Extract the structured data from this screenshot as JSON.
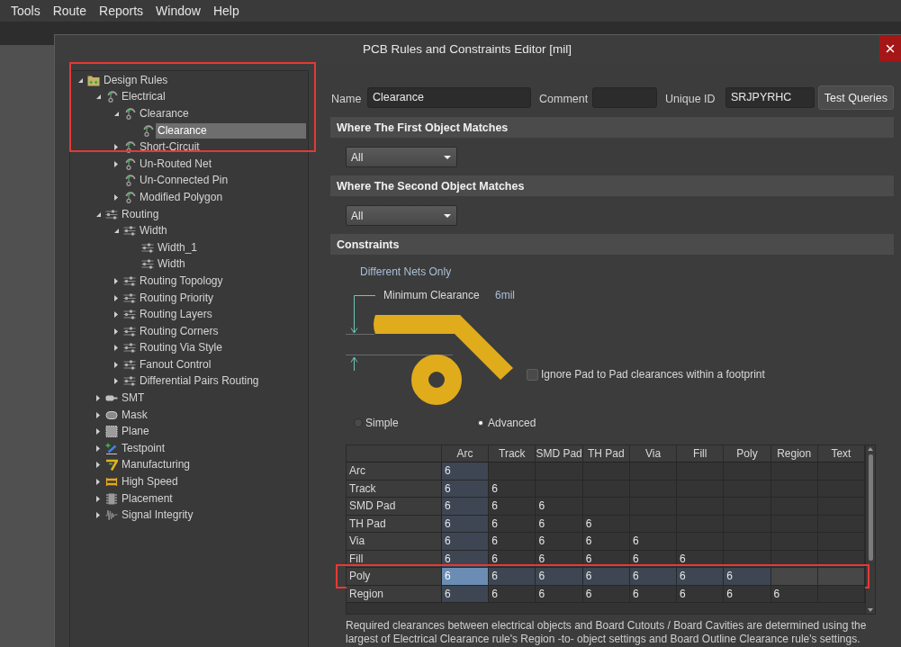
{
  "menu_bar": [
    {
      "label": "Tools"
    },
    {
      "label": "Route"
    },
    {
      "label": "Reports"
    },
    {
      "label": "Window"
    },
    {
      "label": "Help"
    }
  ],
  "dialog": {
    "title": "PCB Rules and Constraints Editor [mil]"
  },
  "tree": {
    "highlighted": true,
    "items": [
      {
        "label": "Design Rules",
        "kind": "folder",
        "expanded": true,
        "selected": false,
        "children": [
          {
            "label": "Electrical",
            "kind": "electrical",
            "expanded": true,
            "selected": false,
            "children": [
              {
                "label": "Clearance",
                "kind": "electrical",
                "expanded": true,
                "selected": false,
                "children": [
                  {
                    "label": "Clearance",
                    "kind": "electrical",
                    "selected": true
                  }
                ]
              },
              {
                "label": "Short-Circuit",
                "kind": "electrical",
                "expanded": false,
                "selected": false
              },
              {
                "label": "Un-Routed Net",
                "kind": "electrical",
                "expanded": false,
                "selected": false
              },
              {
                "label": "Un-Connected Pin",
                "kind": "electrical",
                "selected": false
              },
              {
                "label": "Modified Polygon",
                "kind": "electrical",
                "expanded": false,
                "selected": false
              }
            ]
          },
          {
            "label": "Routing",
            "kind": "routing",
            "expanded": true,
            "selected": false,
            "children": [
              {
                "label": "Width",
                "kind": "routing",
                "expanded": true,
                "selected": false,
                "children": [
                  {
                    "label": "Width_1",
                    "kind": "routing",
                    "selected": false
                  },
                  {
                    "label": "Width",
                    "kind": "routing",
                    "selected": false
                  }
                ]
              },
              {
                "label": "Routing Topology",
                "kind": "routing",
                "expanded": false,
                "selected": false
              },
              {
                "label": "Routing Priority",
                "kind": "routing",
                "expanded": false,
                "selected": false
              },
              {
                "label": "Routing Layers",
                "kind": "routing",
                "expanded": false,
                "selected": false
              },
              {
                "label": "Routing Corners",
                "kind": "routing",
                "expanded": false,
                "selected": false
              },
              {
                "label": "Routing Via Style",
                "kind": "routing",
                "expanded": false,
                "selected": false
              },
              {
                "label": "Fanout Control",
                "kind": "routing",
                "expanded": false,
                "selected": false
              },
              {
                "label": "Differential Pairs Routing",
                "kind": "routing",
                "expanded": false,
                "selected": false
              }
            ]
          },
          {
            "label": "SMT",
            "kind": "smt",
            "expanded": false,
            "selected": false
          },
          {
            "label": "Mask",
            "kind": "mask",
            "expanded": false,
            "selected": false
          },
          {
            "label": "Plane",
            "kind": "plane",
            "expanded": false,
            "selected": false
          },
          {
            "label": "Testpoint",
            "kind": "testpoint",
            "expanded": false,
            "selected": false
          },
          {
            "label": "Manufacturing",
            "kind": "manufacturing",
            "expanded": false,
            "selected": false
          },
          {
            "label": "High Speed",
            "kind": "high_speed",
            "expanded": false,
            "selected": false
          },
          {
            "label": "Placement",
            "kind": "placement",
            "expanded": false,
            "selected": false
          },
          {
            "label": "Signal Integrity",
            "kind": "signal_integrity",
            "expanded": false,
            "selected": false
          }
        ]
      }
    ]
  },
  "rule": {
    "name": {
      "label": "Name",
      "value": "Clearance"
    },
    "comment": {
      "label": "Comment"
    },
    "unique_id": {
      "label": "Unique ID",
      "value": "SRJPYRHC"
    },
    "test_button": "Test Queries"
  },
  "first_object": {
    "heading": "Where The First Object Matches",
    "scope": "All"
  },
  "second_object": {
    "heading": "Where The Second Object Matches",
    "scope": "All"
  },
  "constraints": {
    "heading": "Constraints",
    "net_scope": "Different Nets Only",
    "clearance_label": "Minimum Clearance",
    "clearance_value": "6mil",
    "ignore_pad_to_pad": {
      "label": "Ignore Pad to Pad clearances within a footprint",
      "checked": false
    },
    "modes": [
      {
        "label": "Simple",
        "selected": false
      },
      {
        "label": "Advanced",
        "selected": true
      }
    ],
    "table": {
      "columns": [
        {
          "label": "Arc",
          "selected": true
        },
        {
          "label": "Track",
          "selected": false
        },
        {
          "label": "SMD Pad",
          "selected": false
        },
        {
          "label": "TH Pad",
          "selected": false
        },
        {
          "label": "Via",
          "selected": false
        },
        {
          "label": "Fill",
          "selected": false
        },
        {
          "label": "Poly",
          "selected": false
        },
        {
          "label": "Region",
          "selected": false
        },
        {
          "label": "Text",
          "selected": false
        }
      ],
      "rows": [
        {
          "label": "Arc",
          "selected": false,
          "highlighted": false,
          "cells": [
            "6"
          ]
        },
        {
          "label": "Track",
          "selected": false,
          "highlighted": false,
          "cells": [
            "6",
            "6"
          ]
        },
        {
          "label": "SMD Pad",
          "selected": false,
          "highlighted": false,
          "cells": [
            "6",
            "6",
            "6"
          ]
        },
        {
          "label": "TH Pad",
          "selected": false,
          "highlighted": false,
          "cells": [
            "6",
            "6",
            "6",
            "6"
          ]
        },
        {
          "label": "Via",
          "selected": false,
          "highlighted": false,
          "cells": [
            "6",
            "6",
            "6",
            "6",
            "6"
          ]
        },
        {
          "label": "Fill",
          "selected": false,
          "highlighted": false,
          "cells": [
            "6",
            "6",
            "6",
            "6",
            "6",
            "6"
          ]
        },
        {
          "label": "Poly",
          "selected": true,
          "highlighted": true,
          "cells": [
            "6",
            "6",
            "6",
            "6",
            "6",
            "6",
            "6"
          ]
        },
        {
          "label": "Region",
          "selected": false,
          "highlighted": false,
          "cells": [
            "6",
            "6",
            "6",
            "6",
            "6",
            "6",
            "6",
            "6"
          ]
        }
      ]
    },
    "note": "Required clearances between electrical objects and Board Cutouts / Board Cavities are determined using the largest of Electrical Clearance rule's Region -to- object settings and Board Outline Clearance rule's settings."
  }
}
